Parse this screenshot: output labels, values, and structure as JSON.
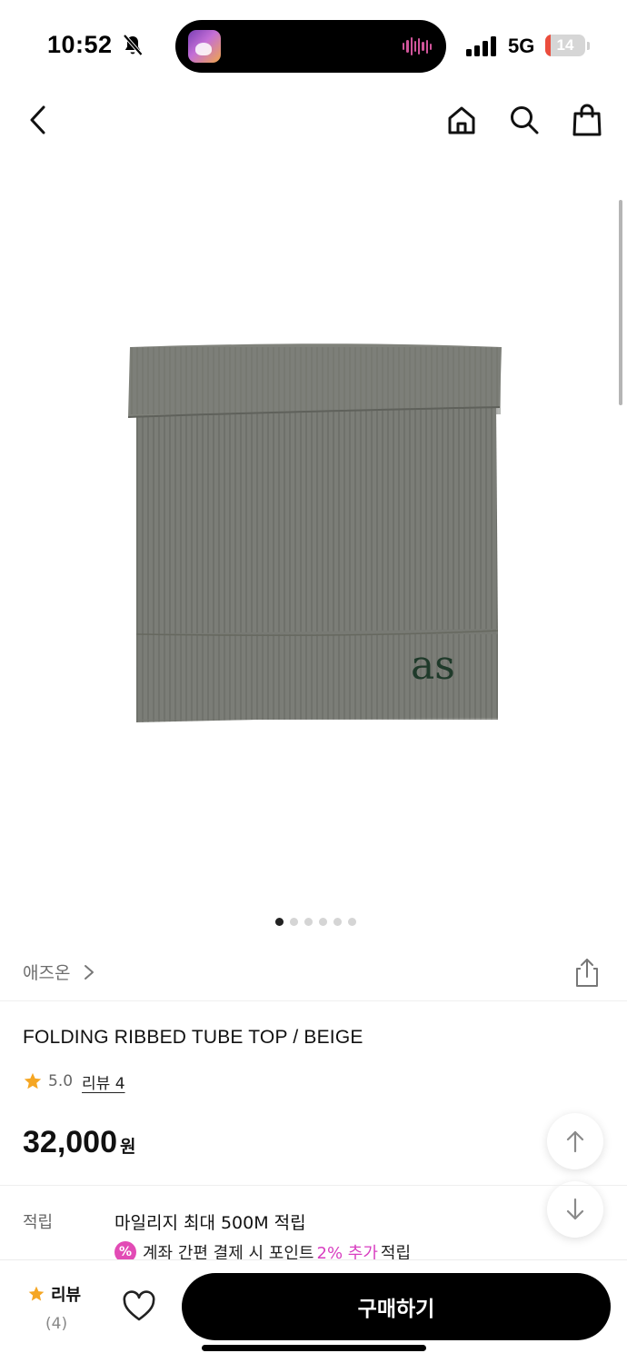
{
  "status_bar": {
    "time": "10:52",
    "network": "5G",
    "battery_level": "14",
    "battery_fraction": 0.14,
    "silent_mode_icon": "bell-slash-icon"
  },
  "nav": {
    "back_icon": "chevron-left-icon",
    "home_icon": "home-icon",
    "search_icon": "search-icon",
    "cart_icon": "shopping-bag-icon"
  },
  "gallery": {
    "image_count": 6,
    "active_index": 0,
    "logo_text": "as"
  },
  "brand": {
    "name": "애즈온"
  },
  "product": {
    "title": "FOLDING RIBBED TUBE TOP / BEIGE",
    "rating": "5.0",
    "review_link": "리뷰 4",
    "price": "32,000",
    "price_unit": "원"
  },
  "points": {
    "label": "적립",
    "main": "마일리지 최대 500M 적립",
    "promo_prefix": "계좌 간편 결제 시 포인트",
    "promo_highlight": "2% 추가",
    "promo_suffix": "적립",
    "promo_icon_text": "%"
  },
  "bottom_bar": {
    "review_label": "리뷰",
    "review_count": "(4)",
    "buy_label": "구매하기"
  },
  "colors": {
    "accent_pink": "#d83ec0",
    "star": "#f5a623",
    "buy_button": "#000000",
    "battery_low": "#eb4d3d"
  }
}
